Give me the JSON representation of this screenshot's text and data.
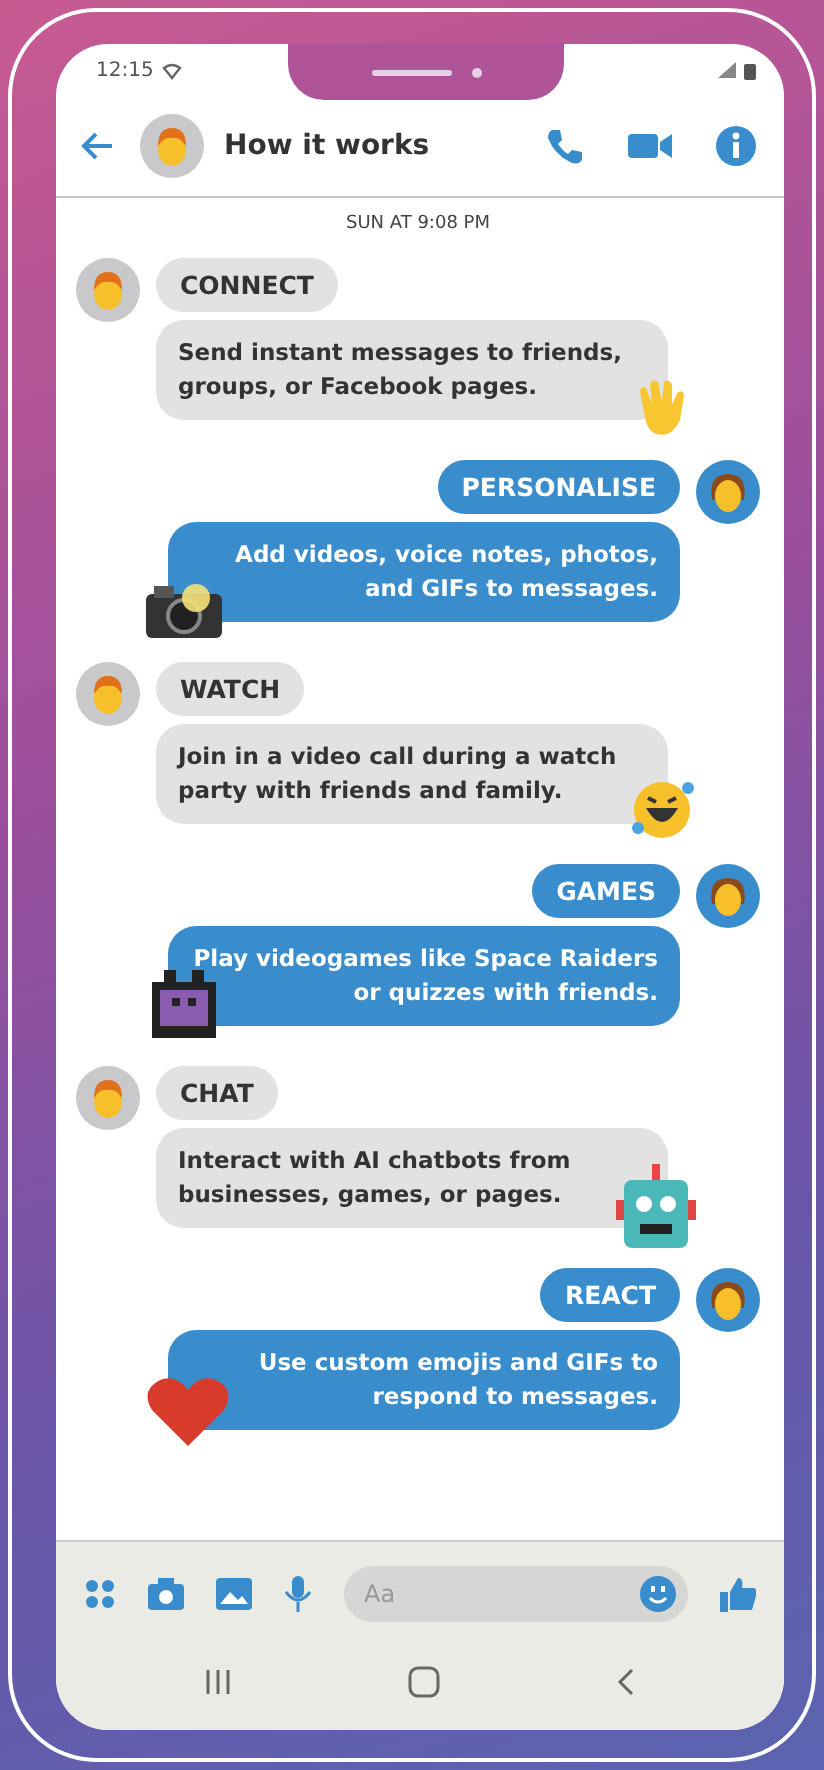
{
  "status_bar": {
    "time": "12:15"
  },
  "header": {
    "title": "How it works"
  },
  "timestamp": "SUN AT 9:08 PM",
  "messages": [
    {
      "kind": "received",
      "title": "CONNECT",
      "text": "Send instant messages to friends, groups, or Facebook pages."
    },
    {
      "kind": "sent",
      "title": "PERSONALISE",
      "text": "Add videos, voice notes, photos, and GIFs to messages."
    },
    {
      "kind": "received",
      "title": "WATCH",
      "text": "Join in a video call during a watch party with friends and family."
    },
    {
      "kind": "sent",
      "title": "GAMES",
      "text": "Play videogames like Space Raiders or quizzes with friends."
    },
    {
      "kind": "received",
      "title": "CHAT",
      "text": "Interact with AI chatbots from businesses, games, or pages."
    },
    {
      "kind": "sent",
      "title": "REACT",
      "text": "Use custom emojis and GIFs to respond to messages."
    }
  ],
  "composer": {
    "placeholder": "Aa"
  }
}
